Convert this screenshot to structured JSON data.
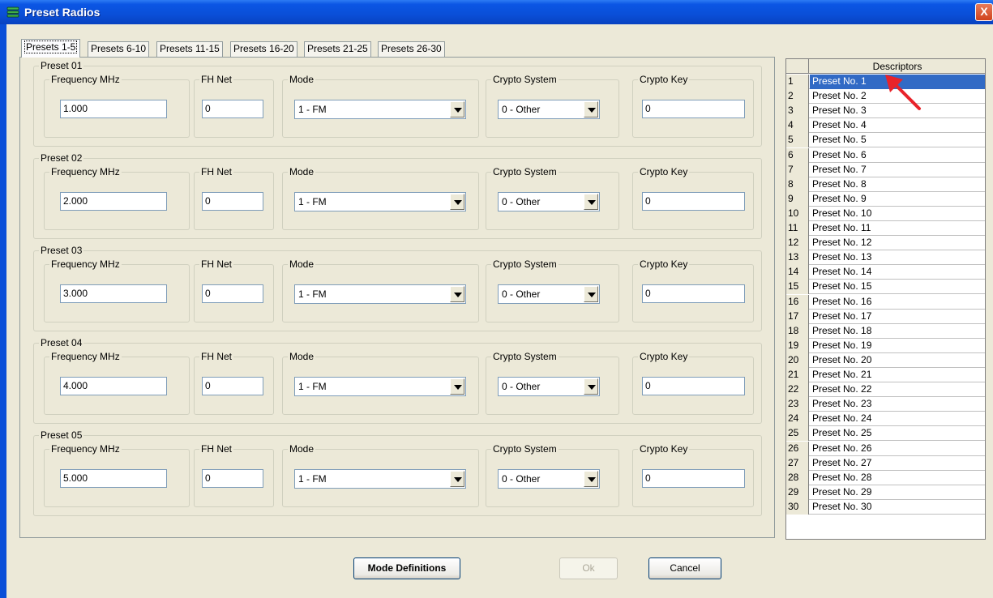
{
  "window": {
    "title": "Preset Radios",
    "close_label": "X"
  },
  "tabs": [
    {
      "label": "Presets 1-5",
      "active": true
    },
    {
      "label": "Presets 6-10",
      "active": false
    },
    {
      "label": "Presets 11-15",
      "active": false
    },
    {
      "label": "Presets 16-20",
      "active": false
    },
    {
      "label": "Presets 21-25",
      "active": false
    },
    {
      "label": "Presets 26-30",
      "active": false
    }
  ],
  "field_labels": {
    "frequency": "Frequency MHz",
    "fh_net": "FH Net",
    "mode": "Mode",
    "crypto_system": "Crypto System",
    "crypto_key": "Crypto Key"
  },
  "presets": [
    {
      "title": "Preset 01",
      "frequency": "1.000",
      "fh_net": "0",
      "mode": "1 - FM",
      "crypto_system": "0 - Other",
      "crypto_key": "0"
    },
    {
      "title": "Preset 02",
      "frequency": "2.000",
      "fh_net": "0",
      "mode": "1 - FM",
      "crypto_system": "0 - Other",
      "crypto_key": "0"
    },
    {
      "title": "Preset 03",
      "frequency": "3.000",
      "fh_net": "0",
      "mode": "1 - FM",
      "crypto_system": "0 - Other",
      "crypto_key": "0"
    },
    {
      "title": "Preset 04",
      "frequency": "4.000",
      "fh_net": "0",
      "mode": "1 - FM",
      "crypto_system": "0 - Other",
      "crypto_key": "0"
    },
    {
      "title": "Preset 05",
      "frequency": "5.000",
      "fh_net": "0",
      "mode": "1 - FM",
      "crypto_system": "0 - Other",
      "crypto_key": "0"
    }
  ],
  "descriptors": {
    "header": "Descriptors",
    "selected_index": 0,
    "rows": [
      {
        "num": "1",
        "label": "Preset No. 1"
      },
      {
        "num": "2",
        "label": "Preset No. 2"
      },
      {
        "num": "3",
        "label": "Preset No. 3"
      },
      {
        "num": "4",
        "label": "Preset No. 4"
      },
      {
        "num": "5",
        "label": "Preset No. 5"
      },
      {
        "num": "6",
        "label": "Preset No. 6"
      },
      {
        "num": "7",
        "label": "Preset No. 7"
      },
      {
        "num": "8",
        "label": "Preset No. 8"
      },
      {
        "num": "9",
        "label": "Preset No. 9"
      },
      {
        "num": "10",
        "label": "Preset No. 10"
      },
      {
        "num": "11",
        "label": "Preset No. 11"
      },
      {
        "num": "12",
        "label": "Preset No. 12"
      },
      {
        "num": "13",
        "label": "Preset No. 13"
      },
      {
        "num": "14",
        "label": "Preset No. 14"
      },
      {
        "num": "15",
        "label": "Preset No. 15"
      },
      {
        "num": "16",
        "label": "Preset No. 16"
      },
      {
        "num": "17",
        "label": "Preset No. 17"
      },
      {
        "num": "18",
        "label": "Preset No. 18"
      },
      {
        "num": "19",
        "label": "Preset No. 19"
      },
      {
        "num": "20",
        "label": "Preset No. 20"
      },
      {
        "num": "21",
        "label": "Preset No. 21"
      },
      {
        "num": "22",
        "label": "Preset No. 22"
      },
      {
        "num": "23",
        "label": "Preset No. 23"
      },
      {
        "num": "24",
        "label": "Preset No. 24"
      },
      {
        "num": "25",
        "label": "Preset No. 25"
      },
      {
        "num": "26",
        "label": "Preset No. 26"
      },
      {
        "num": "27",
        "label": "Preset No. 27"
      },
      {
        "num": "28",
        "label": "Preset No. 28"
      },
      {
        "num": "29",
        "label": "Preset No. 29"
      },
      {
        "num": "30",
        "label": "Preset No. 30"
      }
    ]
  },
  "buttons": {
    "mode_definitions": "Mode Definitions",
    "ok": "Ok",
    "cancel": "Cancel"
  },
  "colors": {
    "titlebar": "#0a4fd8",
    "selection": "#316ac5",
    "annotation_arrow": "#e8232a"
  },
  "icons": {
    "title": "radio-stack-icon",
    "close": "close-icon",
    "dropdown": "chevron-down-icon",
    "annotation": "red-arrow-icon"
  }
}
